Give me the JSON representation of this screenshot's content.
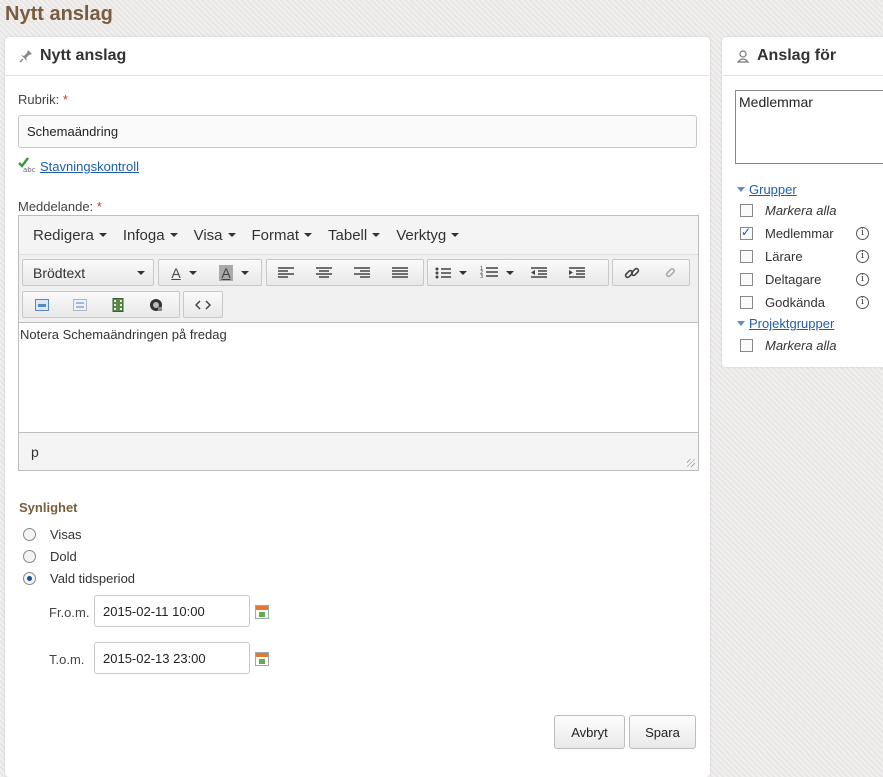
{
  "page": {
    "title": "Nytt anslag"
  },
  "main": {
    "header": "Nytt anslag",
    "header_icon": "pin-icon",
    "subject_label": "Rubrik:",
    "required_mark": "*",
    "subject_value": "Schemaändring",
    "spellcheck_link": "Stavningskontroll",
    "message_label": "Meddelande:",
    "editor": {
      "menus": [
        "Redigera",
        "Infoga",
        "Visa",
        "Format",
        "Tabell",
        "Verktyg"
      ],
      "block_format": "Brödtext",
      "content": "Notera Schemaändringen på fredag",
      "status_path": "p"
    },
    "visibility": {
      "title": "Synlighet",
      "options": [
        "Visas",
        "Dold",
        "Vald tidsperiod"
      ],
      "selected": "Vald tidsperiod",
      "from_label": "Fr.o.m.",
      "from_value": "2015-02-11 10:00",
      "to_label": "T.o.m.",
      "to_value": "2015-02-13 23:00"
    },
    "buttons": {
      "cancel": "Avbryt",
      "save": "Spara"
    }
  },
  "side": {
    "header": "Anslag för",
    "header_icon": "user-icon",
    "selected_text": "Medlemmar",
    "groups_label": "Grupper",
    "groups": [
      {
        "label": "Markera alla",
        "checked": false,
        "italic": true,
        "info": false
      },
      {
        "label": "Medlemmar",
        "checked": true,
        "italic": false,
        "info": true
      },
      {
        "label": "Lärare",
        "checked": false,
        "italic": false,
        "info": true
      },
      {
        "label": "Deltagare",
        "checked": false,
        "italic": false,
        "info": true
      },
      {
        "label": "Godkända",
        "checked": false,
        "italic": false,
        "info": true
      }
    ],
    "project_groups_label": "Projektgrupper",
    "project_groups": [
      {
        "label": "Markera alla",
        "checked": false,
        "italic": true
      }
    ]
  },
  "colors": {
    "accent_brown": "#7a5c3e",
    "link_blue": "#1f5fa8",
    "required_red": "#c0392b"
  }
}
